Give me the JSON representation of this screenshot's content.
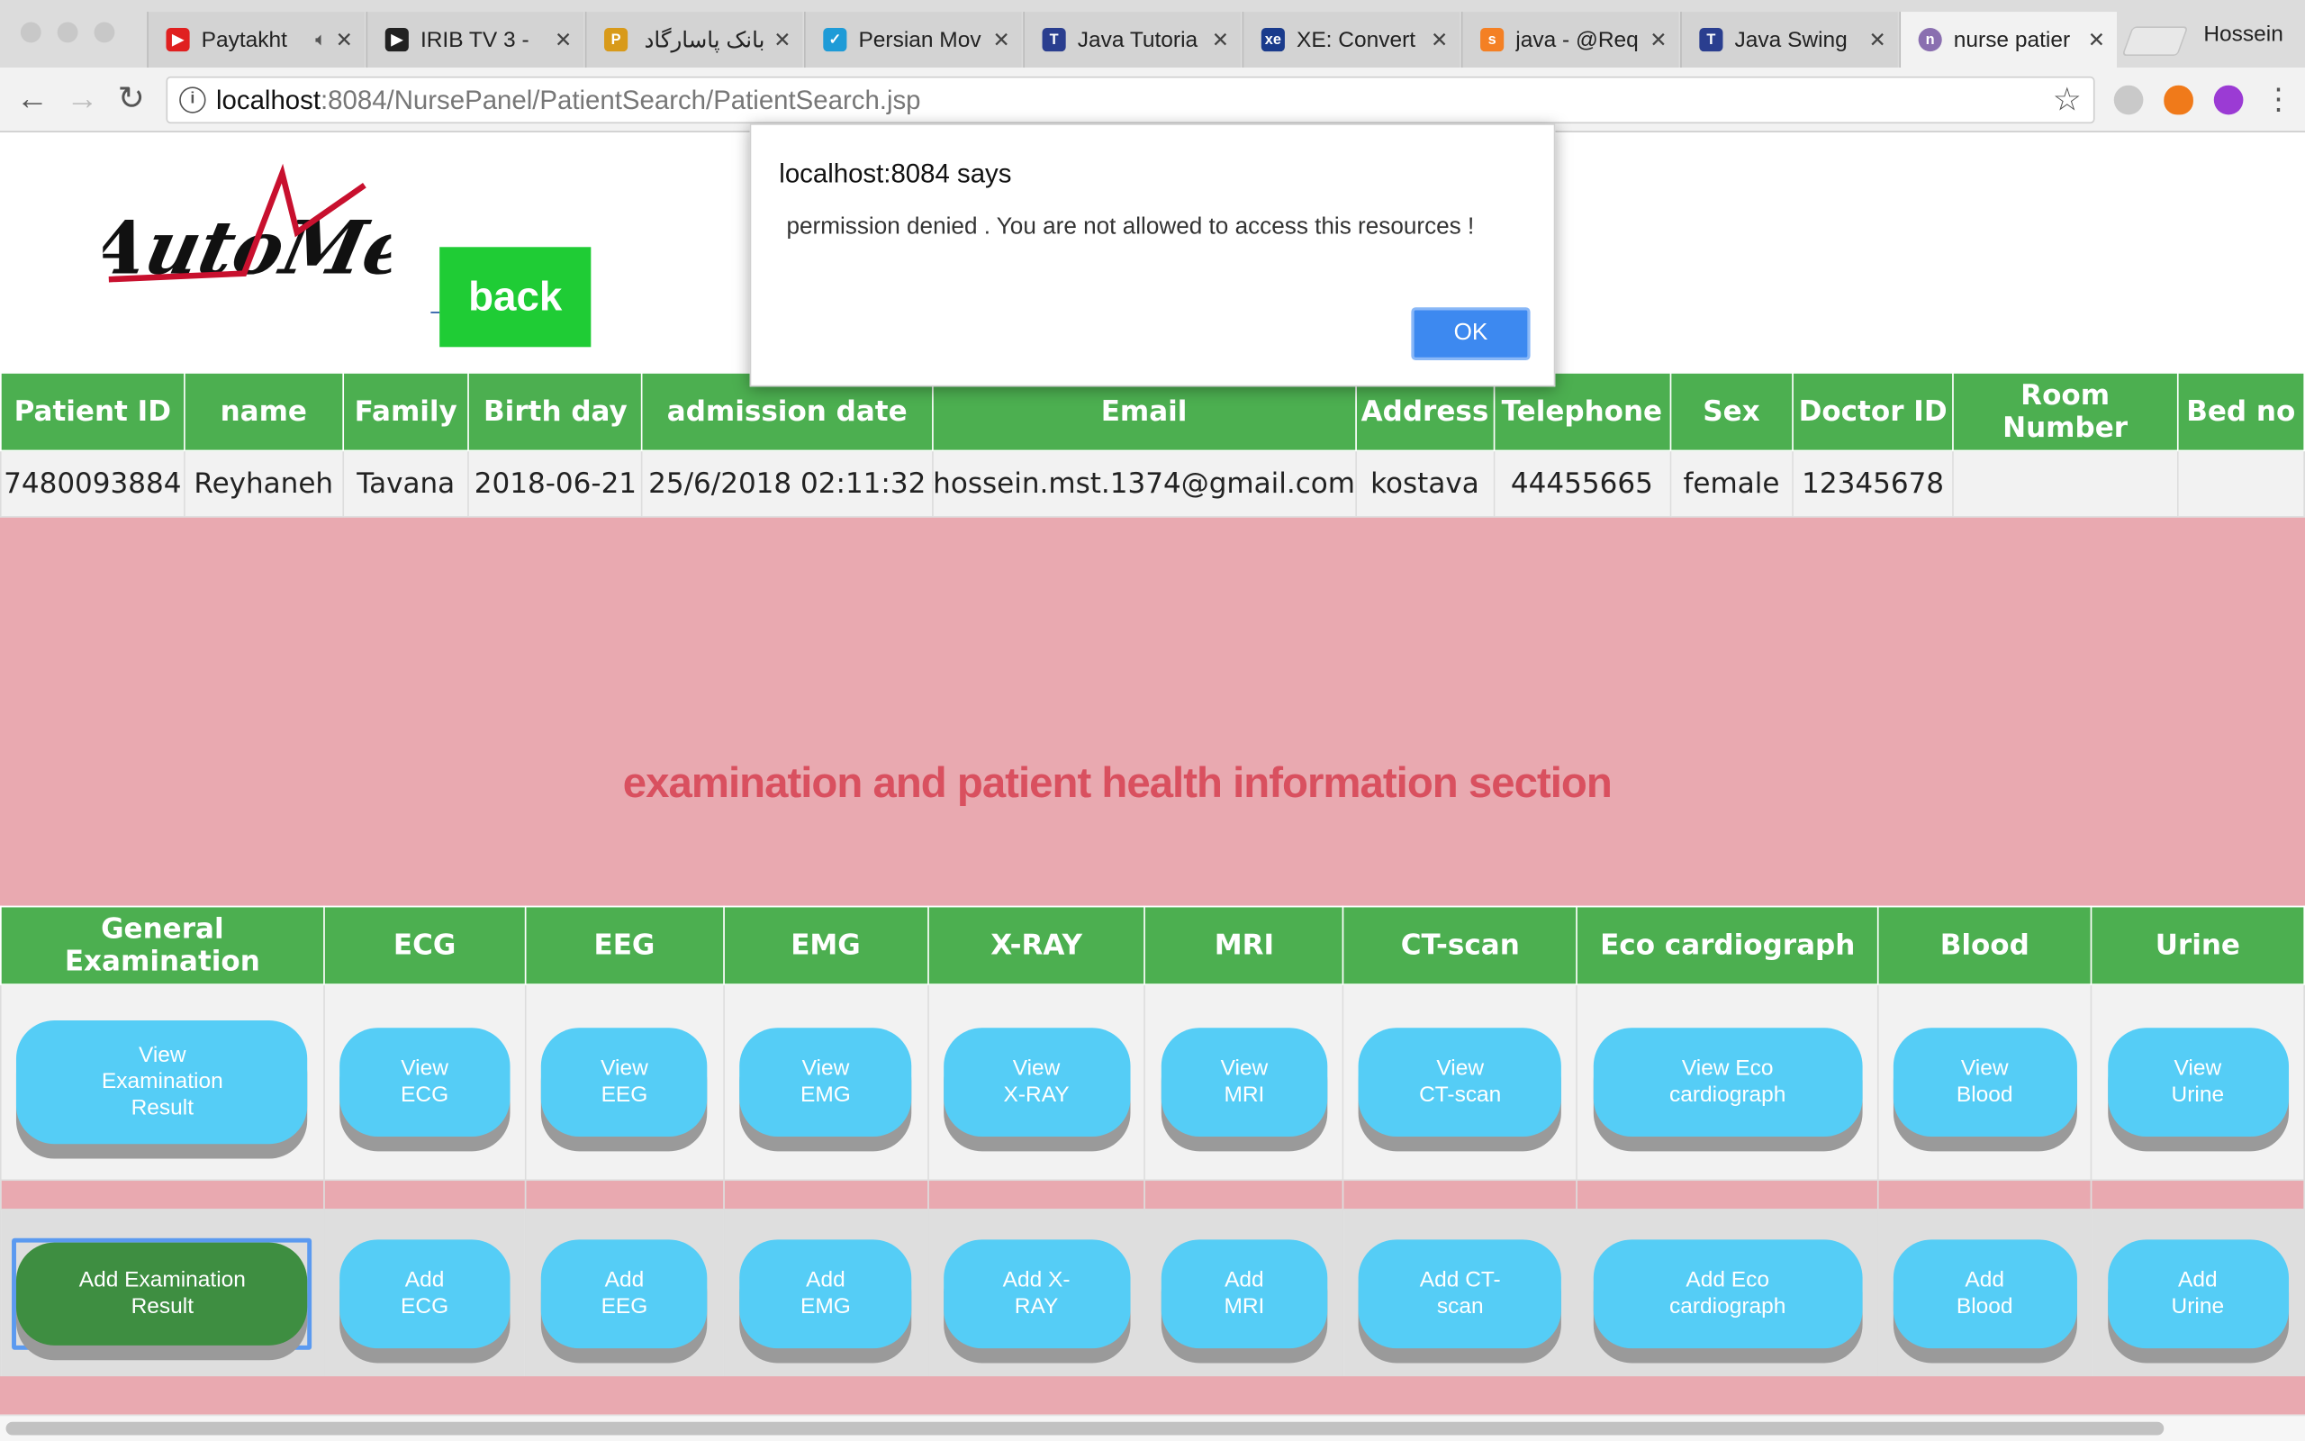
{
  "browser": {
    "tabs": [
      {
        "title": "Paytakht",
        "color": "#e02020",
        "glyph": "▶"
      },
      {
        "title": "IRIB TV 3 - ",
        "color": "#222222",
        "glyph": "▶"
      },
      {
        "title": "بانک پاسارگاد ::",
        "color": "#d89a1a",
        "glyph": "P"
      },
      {
        "title": "Persian Mov",
        "color": "#1e9bd7",
        "glyph": "✓"
      },
      {
        "title": "Java Tutoria",
        "color": "#2a3e8f",
        "glyph": "T"
      },
      {
        "title": "XE: Convert",
        "color": "#1a3b8c",
        "glyph": "xe"
      },
      {
        "title": "java - @Req",
        "color": "#f48024",
        "glyph": "s"
      },
      {
        "title": "Java Swing",
        "color": "#2a3e8f",
        "glyph": "T"
      },
      {
        "title": "nurse patier",
        "color": "#8a6fb0",
        "glyph": "n"
      }
    ],
    "profile_name": "Hossein",
    "url_host": "localhost",
    "url_rest": ":8084/NursePanel/PatientSearch/PatientSearch.jsp"
  },
  "page": {
    "logo_text": "AutoMed",
    "back_label": "back",
    "patient_headers": [
      "Patient ID",
      "name",
      "Family",
      "Birth day",
      "admission date",
      "Email",
      "Address",
      "Telephone",
      "Sex",
      "Doctor ID",
      "Room Number",
      "Bed no"
    ],
    "patient_row": [
      "7480093884",
      "Reyhaneh",
      "Tavana",
      "2018-06-21",
      "25/6/2018 02:11:32",
      "hossein.mst.1374@gmail.com",
      "kostava",
      "44455665",
      "female",
      "12345678",
      "",
      ""
    ],
    "section_title": "examination and patient health information section",
    "exam_headers": [
      "General Examination",
      "ECG",
      "EEG",
      "EMG",
      "X-RAY",
      "MRI",
      "CT-scan",
      "Eco cardiograph",
      "Blood",
      "Urine"
    ],
    "view_buttons": [
      "View\nExamination\nResult",
      "View\nECG",
      "View\nEEG",
      "View\nEMG",
      "View\nX-RAY",
      "View\nMRI",
      "View\nCT-scan",
      "View Eco\ncardiograph",
      "View\nBlood",
      "View\nUrine"
    ],
    "add_buttons": [
      "Add Examination\nResult",
      "Add\nECG",
      "Add\nEEG",
      "Add\nEMG",
      "Add X-\nRAY",
      "Add\nMRI",
      "Add CT-\nscan",
      "Add Eco\ncardiograph",
      "Add\nBlood",
      "Add\nUrine"
    ]
  },
  "dialog": {
    "title": "localhost:8084 says",
    "message": "permission denied . You are not allowed to access this resources !",
    "ok_label": "OK"
  },
  "colors": {
    "table_header": "#4caf50",
    "back_button": "#1fcc35",
    "pill_button": "#55cdf6",
    "pill_button_active": "#3e8e41",
    "pink_band": "#e9a9b0",
    "section_title": "#d9505f",
    "dialog_ok": "#3d89f0"
  }
}
